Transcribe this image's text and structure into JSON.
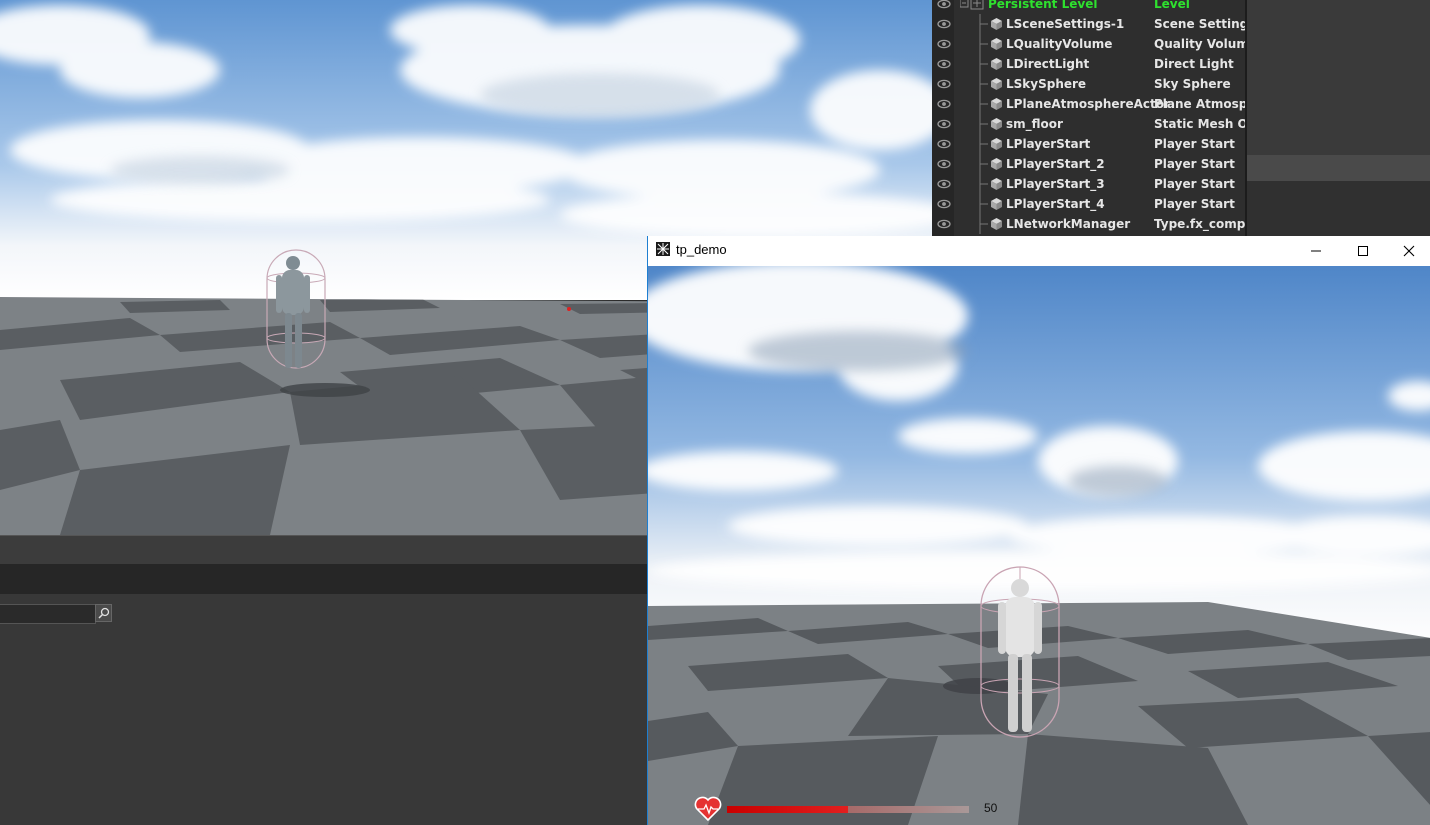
{
  "outliner": {
    "rows": [
      {
        "name": "Persistent Level",
        "type": "Level",
        "root": true
      },
      {
        "name": "LSceneSettings-1",
        "type": "Scene Settings"
      },
      {
        "name": "LQualityVolume",
        "type": "Quality Volume"
      },
      {
        "name": "LDirectLight",
        "type": "Direct Light"
      },
      {
        "name": "LSkySphere",
        "type": "Sky Sphere"
      },
      {
        "name": "LPlaneAtmosphereActor",
        "type": "Plane Atmosph"
      },
      {
        "name": "sm_floor",
        "type": "Static Mesh Obj"
      },
      {
        "name": "LPlayerStart",
        "type": "Player Start"
      },
      {
        "name": "LPlayerStart_2",
        "type": "Player Start"
      },
      {
        "name": "LPlayerStart_3",
        "type": "Player Start"
      },
      {
        "name": "LPlayerStart_4",
        "type": "Player Start"
      },
      {
        "name": "LNetworkManager",
        "type": "Type.fx_compo"
      }
    ]
  },
  "game_window": {
    "title": "tp_demo",
    "health": {
      "value": "50",
      "fraction": 0.5
    }
  },
  "icons": {
    "visibility": "eye-icon",
    "actor": "cube-icon",
    "search": "search-icon",
    "health": "heart-icon",
    "app": "app-icon"
  },
  "colors": {
    "level_text": "#2ee12e",
    "outliner_text": "#e6e6e6",
    "health_fill": "#d10f0f",
    "window_accent": "#1e7fd1"
  }
}
